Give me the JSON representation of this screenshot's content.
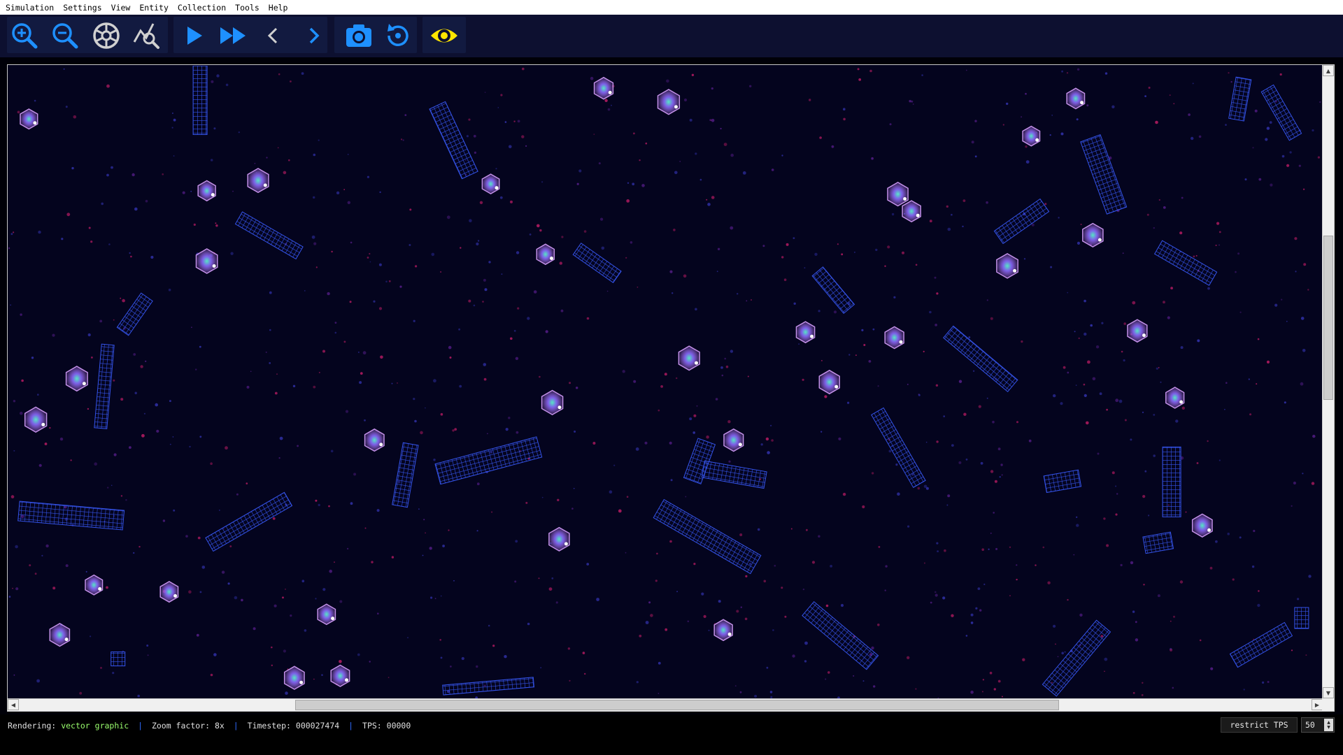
{
  "menu": [
    {
      "label": "Simulation"
    },
    {
      "label": "Settings"
    },
    {
      "label": "View"
    },
    {
      "label": "Entity"
    },
    {
      "label": "Collection"
    },
    {
      "label": "Tools"
    },
    {
      "label": "Help"
    }
  ],
  "toolbar": {
    "buttons": [
      {
        "icon": "zoom-in-icon",
        "name": "zoom-in-button"
      },
      {
        "icon": "zoom-out-icon",
        "name": "zoom-out-button"
      },
      {
        "icon": "cell-network-icon",
        "name": "navigation-button"
      },
      {
        "icon": "inspect-icon",
        "name": "action-mode-button"
      },
      {
        "icon": "play-icon",
        "name": "play-button"
      },
      {
        "icon": "fast-forward-icon",
        "name": "fast-forward-button"
      },
      {
        "icon": "step-backward-icon",
        "name": "step-backward-button"
      },
      {
        "icon": "step-forward-icon",
        "name": "step-forward-button"
      },
      {
        "icon": "camera-icon",
        "name": "snapshot-button"
      },
      {
        "icon": "restore-icon",
        "name": "restore-button"
      },
      {
        "icon": "eye-icon",
        "name": "visibility-button"
      }
    ],
    "colors": {
      "primary": "#1e90ff",
      "secondary": "#d0d0d0",
      "eye": "#ffe600"
    }
  },
  "world": {
    "colors": {
      "background": "#04041e",
      "grid": "#3a5cff",
      "cell_glow": "#c67bff",
      "dust_red": "#c0205a",
      "dust_blue": "#3040c0"
    }
  },
  "status": {
    "rendering_label": "Rendering:",
    "rendering_value": "vector graphic",
    "separator": "|",
    "zoom_label": "Zoom factor:",
    "zoom_value": "8x",
    "timestep_label": "Timestep:",
    "timestep_value": "000027474",
    "tps_label": "TPS:",
    "tps_value": "00000",
    "restrict_label": "restrict TPS",
    "restrict_value": "50"
  }
}
